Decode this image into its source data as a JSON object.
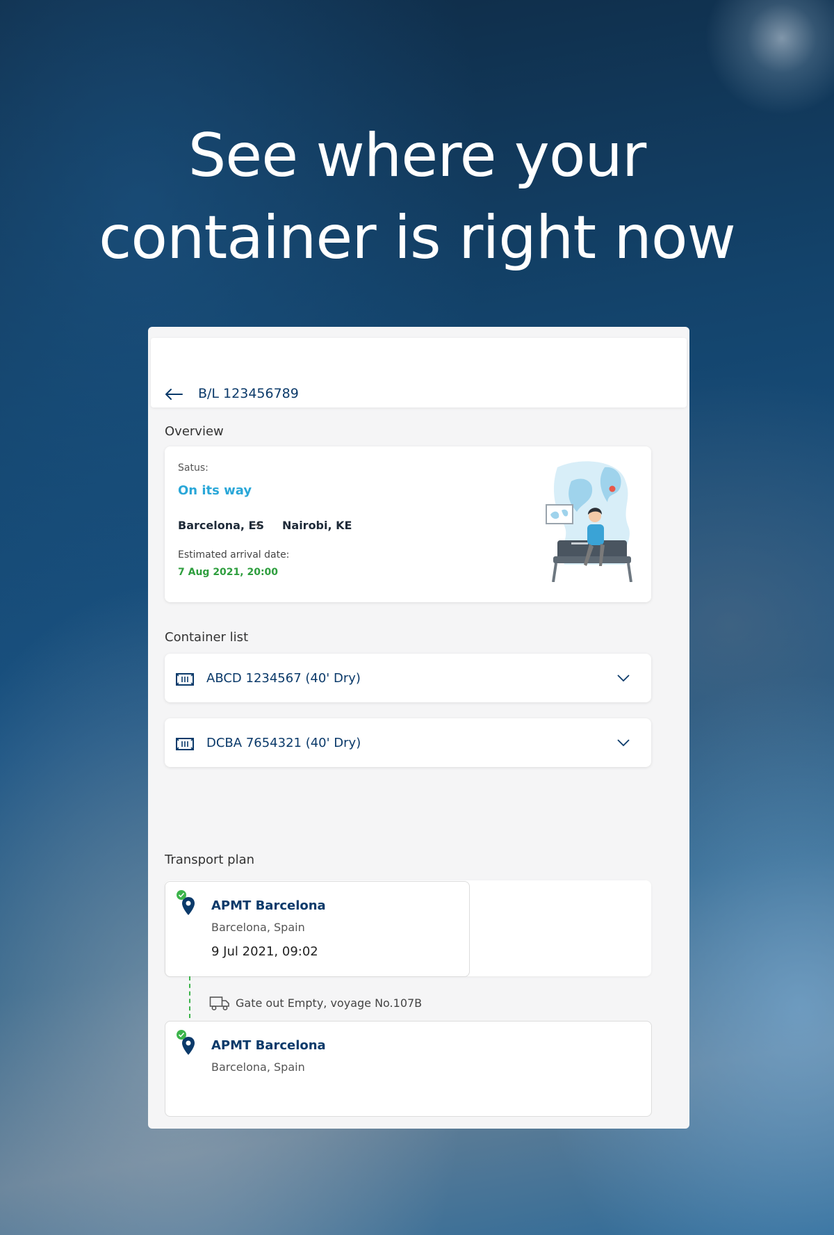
{
  "hero": {
    "line1": "See where your",
    "line2": "container is right now"
  },
  "header": {
    "back_icon": "arrow-left-icon",
    "title": "B/L 123456789"
  },
  "overview": {
    "section_label": "Overview",
    "status_label": "Satus:",
    "status": "On its way",
    "origin": "Barcelona, ES",
    "arrow": "→",
    "destination": "Nairobi, KE",
    "eta_label": "Estimated arrival date:",
    "eta": "7 Aug 2021, 20:00"
  },
  "container_list": {
    "section_label": "Container list",
    "items": [
      {
        "label": "ABCD 1234567 (40' Dry)",
        "icon": "container-icon",
        "chevron": "chevron-down-icon"
      },
      {
        "label": "DCBA 7654321 (40' Dry)",
        "icon": "container-icon",
        "chevron": "chevron-down-icon"
      }
    ]
  },
  "transport_plan": {
    "section_label": "Transport plan",
    "stops": [
      {
        "name": "APMT Barcelona",
        "place": "Barcelona, Spain",
        "date": "9 Jul 2021, 09:02",
        "icon": "location-pin-icon"
      },
      {
        "name": "APMT Barcelona",
        "place": "Barcelona, Spain",
        "icon": "location-pin-icon"
      }
    ],
    "event": {
      "label": "Gate out Empty, voyage No.107B",
      "icon": "truck-icon"
    }
  },
  "colors": {
    "brand_blue": "#0b3a6a",
    "status_blue": "#2aa7d8",
    "eta_green": "#2e9e3e",
    "check_green": "#3cb44b"
  }
}
